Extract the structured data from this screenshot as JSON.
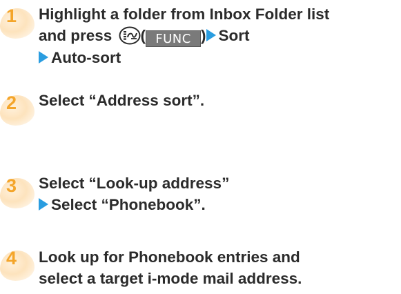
{
  "steps": [
    {
      "number": "1",
      "line1": "Highlight a folder from Inbox Folder list",
      "line2_prefix": "and press ",
      "key_open_paren": "(",
      "func_key_label": "FUNC",
      "key_close_paren": ")",
      "line2_suffix": "Sort",
      "line3": "Auto-sort",
      "icon": "menu-key-icon"
    },
    {
      "number": "2",
      "line1": "Select “Address sort”."
    },
    {
      "number": "3",
      "line1": "Select “Look-up address”",
      "line2": "Select “Phonebook”."
    },
    {
      "number": "4",
      "line1": "Look up for Phonebook entries and",
      "line2": "select a target i-mode mail address."
    }
  ],
  "colors": {
    "step_number": "#f4a52a",
    "arrow": "#2a9de0",
    "text": "#2b2b2b",
    "func_key_bg": "#7a7a7a"
  }
}
